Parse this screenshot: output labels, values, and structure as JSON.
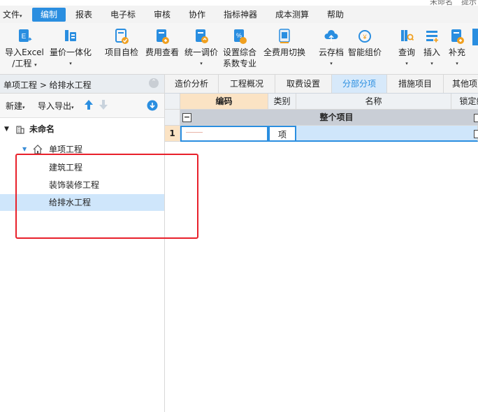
{
  "title_fragments": {
    "left": "未命名",
    "right": "提示"
  },
  "menu": {
    "items": [
      "文件",
      "编制",
      "报表",
      "电子标",
      "审核",
      "协作",
      "指标神器",
      "成本测算",
      "帮助"
    ],
    "active": "编制"
  },
  "ribbon": {
    "buttons": [
      {
        "line1": "导入Excel",
        "line2": "/工程",
        "icon": "excel-import-icon"
      },
      {
        "line1": "量价一体化",
        "line2": "",
        "icon": "price-integration-icon"
      },
      {
        "line1": "项目自检",
        "line2": "",
        "icon": "self-check-icon"
      },
      {
        "line1": "费用查看",
        "line2": "",
        "icon": "fee-view-icon"
      },
      {
        "line1": "统一调价",
        "line2": "",
        "icon": "price-adjust-icon"
      },
      {
        "line1": "设置综合",
        "line2": "系数专业",
        "icon": "coefficient-icon"
      },
      {
        "line1": "全费用切换",
        "line2": "",
        "icon": "full-cost-switch-icon"
      },
      {
        "line1": "云存档",
        "line2": "",
        "icon": "cloud-archive-icon"
      },
      {
        "line1": "智能组价",
        "line2": "",
        "icon": "smart-pricing-icon"
      },
      {
        "line1": "查询",
        "line2": "",
        "icon": "query-icon"
      },
      {
        "line1": "插入",
        "line2": "",
        "icon": "insert-icon"
      },
      {
        "line1": "补充",
        "line2": "",
        "icon": "supplement-icon"
      }
    ]
  },
  "left_panel": {
    "breadcrumb": "单项工程 > 给排水工程",
    "toolbar": {
      "new_label": "新建",
      "import_export_label": "导入导出"
    },
    "tree": {
      "root": "未命名",
      "single": "单项工程",
      "units": [
        "建筑工程",
        "装饰装修工程",
        "给排水工程"
      ],
      "selected": "给排水工程"
    }
  },
  "tabs": [
    "造价分析",
    "工程概况",
    "取费设置",
    "分部分项",
    "措施项目",
    "其他项"
  ],
  "active_tab": "分部分项",
  "grid": {
    "headers": [
      "编码",
      "类别",
      "名称",
      "锁定综"
    ],
    "group_row": "整个项目",
    "rows": [
      {
        "num": "1",
        "code": "",
        "type": "项",
        "name": ""
      }
    ]
  },
  "colors": {
    "accent": "#2a8ee0",
    "highlight_box": "#e8202a",
    "selected": "#cfe6fb"
  }
}
